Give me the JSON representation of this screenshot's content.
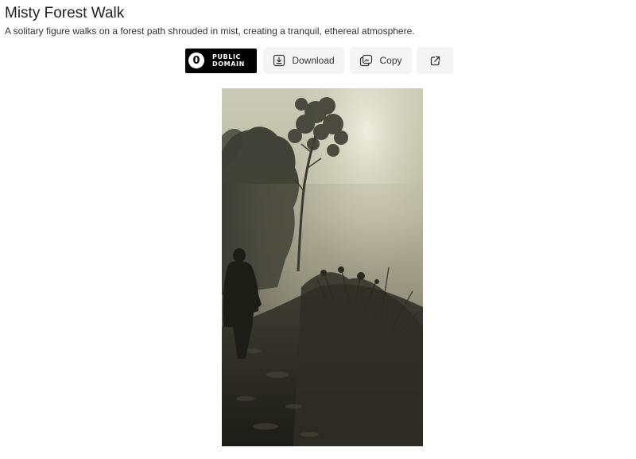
{
  "header": {
    "title": "Misty Forest Walk",
    "description": "A solitary figure walks on a forest path shrouded in mist, creating a tranquil, ethereal atmosphere."
  },
  "toolbar": {
    "license_badge": {
      "symbol": "0",
      "line1": "PUBLIC",
      "line2": "DOMAIN",
      "icon": "public-domain-icon"
    },
    "download_label": "Download",
    "download_icon": "download-icon",
    "copy_label": "Copy",
    "copy_icon": "copy-icon",
    "open_icon": "external-link-icon"
  },
  "colors": {
    "badge_bg": "#000000",
    "button_bg": "#f4f4f4"
  }
}
